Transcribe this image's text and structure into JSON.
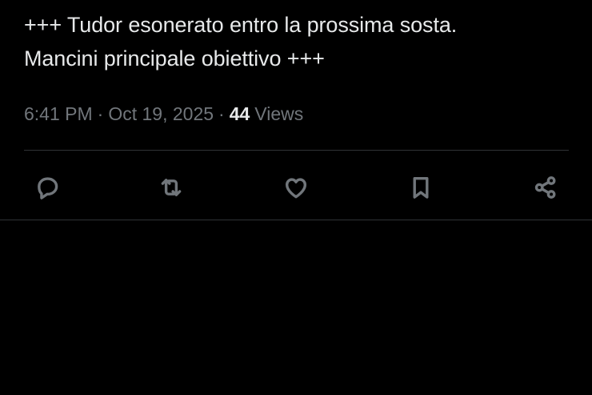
{
  "tweet": {
    "text": "+++ Tudor esonerato entro la prossima sosta.\nMancini principale obiettivo +++",
    "time": "6:41 PM",
    "separator": "·",
    "date": "Oct 19, 2025",
    "views_count": "44",
    "views_label": "Views"
  },
  "actions": {
    "reply_icon": "reply-bubble-icon",
    "retweet_icon": "retweet-arrows-icon",
    "like_icon": "heart-icon",
    "bookmark_icon": "bookmark-icon",
    "share_icon": "share-nodes-icon"
  },
  "colors": {
    "background": "#000000",
    "text": "#e7e9ea",
    "muted": "#71767b",
    "divider": "#2f3336"
  }
}
